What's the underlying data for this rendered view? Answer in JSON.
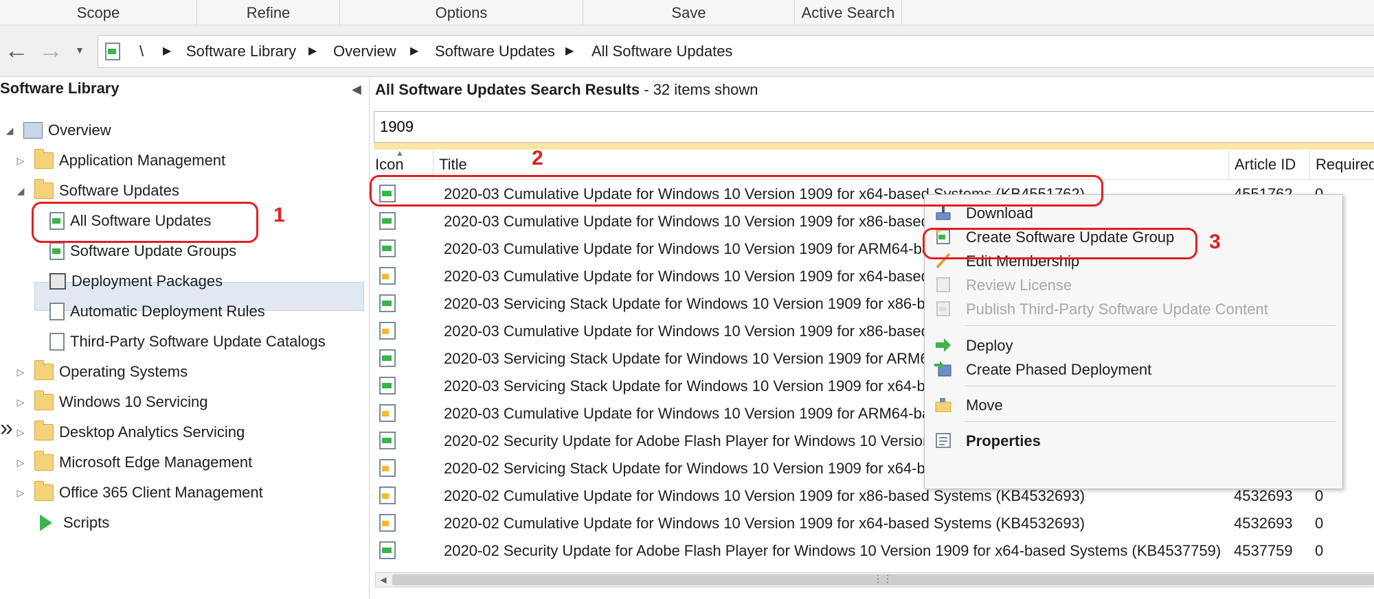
{
  "ribbon": {
    "groups": [
      "Scope",
      "Refine",
      "Options",
      "Save",
      "Active Search"
    ]
  },
  "address_bar": {
    "back_icon": "back-arrow-icon",
    "forward_icon": "forward-arrow-icon",
    "root": "\\",
    "crumbs": [
      "Software Library",
      "Overview",
      "Software Updates",
      "All Software Updates"
    ]
  },
  "navigation": {
    "title": "Software Library",
    "items": [
      {
        "label": "Overview",
        "icon": "overview-icon"
      },
      {
        "label": "Application Management",
        "icon": "folder-icon"
      },
      {
        "label": "Software Updates",
        "icon": "folder-icon"
      },
      {
        "label": "All Software Updates",
        "icon": "software-update-icon",
        "selected": true
      },
      {
        "label": "Software Update Groups",
        "icon": "update-group-icon"
      },
      {
        "label": "Deployment Packages",
        "icon": "package-icon"
      },
      {
        "label": "Automatic Deployment Rules",
        "icon": "rule-icon"
      },
      {
        "label": "Third-Party Software Update Catalogs",
        "icon": "catalog-icon"
      },
      {
        "label": "Operating Systems",
        "icon": "folder-icon"
      },
      {
        "label": "Windows 10 Servicing",
        "icon": "folder-icon"
      },
      {
        "label": "Desktop Analytics Servicing",
        "icon": "folder-icon"
      },
      {
        "label": "Microsoft Edge Management",
        "icon": "folder-icon"
      },
      {
        "label": "Office 365 Client Management",
        "icon": "folder-icon"
      },
      {
        "label": "Scripts",
        "icon": "script-icon"
      }
    ]
  },
  "results": {
    "title": "All Software Updates Search Results",
    "separator": " - ",
    "count": "32 items shown",
    "search_value": "1909",
    "columns": [
      "Icon",
      "Title",
      "Article ID",
      "Required"
    ],
    "rows": [
      {
        "title": "2020-03 Cumulative Update for Windows 10 Version 1909 for x64-based Systems (KB4551762)",
        "article": "4551762",
        "required": "0",
        "icon": "g"
      },
      {
        "title": "2020-03 Cumulative Update for Windows 10 Version 1909 for x86-based",
        "article": "",
        "required": "",
        "icon": "g"
      },
      {
        "title": "2020-03 Cumulative Update for Windows 10 Version 1909 for ARM64-ba",
        "article": "",
        "required": "",
        "icon": "g"
      },
      {
        "title": "2020-03 Cumulative Update for Windows 10 Version 1909 for x64-based",
        "article": "",
        "required": "",
        "icon": "y"
      },
      {
        "title": "2020-03 Servicing Stack Update for Windows 10 Version 1909 for x86-ba",
        "article": "",
        "required": "",
        "icon": "g"
      },
      {
        "title": "2020-03 Cumulative Update for Windows 10 Version 1909 for x86-based",
        "article": "",
        "required": "",
        "icon": "y"
      },
      {
        "title": "2020-03 Servicing Stack Update for Windows 10 Version 1909 for ARM64",
        "article": "",
        "required": "",
        "icon": "g"
      },
      {
        "title": "2020-03 Servicing Stack Update for Windows 10 Version 1909 for x64-ba",
        "article": "",
        "required": "",
        "icon": "g"
      },
      {
        "title": "2020-03 Cumulative Update for Windows 10 Version 1909 for ARM64-ba",
        "article": "",
        "required": "",
        "icon": "y"
      },
      {
        "title": "2020-02 Security Update for Adobe Flash Player for Windows 10 Version",
        "article": "",
        "required": "",
        "icon": "g"
      },
      {
        "title": "2020-02 Servicing Stack Update for Windows 10 Version 1909 for x64-ba",
        "article": "",
        "required": "",
        "icon": "y"
      },
      {
        "title": "2020-02 Cumulative Update for Windows 10 Version 1909 for x86-based Systems (KB4532693)",
        "article": "4532693",
        "required": "0",
        "icon": "y"
      },
      {
        "title": "2020-02 Cumulative Update for Windows 10 Version 1909 for x64-based Systems (KB4532693)",
        "article": "4532693",
        "required": "0",
        "icon": "y"
      },
      {
        "title": "2020-02 Security Update for Adobe Flash Player for Windows 10 Version 1909 for x64-based Systems (KB4537759)",
        "article": "4537759",
        "required": "0",
        "icon": "g"
      }
    ]
  },
  "context_menu": {
    "items": [
      {
        "label": "Download",
        "icon": "download-icon",
        "state": "normal"
      },
      {
        "label": "Create Software Update Group",
        "icon": "create-group-icon",
        "state": "normal"
      },
      {
        "label": "Edit Membership",
        "icon": "pencil-icon",
        "state": "normal"
      },
      {
        "label": "Review License",
        "icon": "license-icon",
        "state": "disabled"
      },
      {
        "label": "Publish Third-Party Software Update Content",
        "icon": "publish-icon",
        "state": "disabled"
      },
      {
        "label": "Deploy",
        "icon": "deploy-arrow-icon",
        "state": "normal"
      },
      {
        "label": "Create Phased Deployment",
        "icon": "phased-deployment-icon",
        "state": "normal"
      },
      {
        "label": "Move",
        "icon": "move-folder-icon",
        "state": "normal"
      },
      {
        "label": "Properties",
        "icon": "properties-icon",
        "state": "bold"
      }
    ]
  },
  "annotations": {
    "steps": [
      "1",
      "2",
      "3"
    ],
    "color": "#e02020"
  },
  "colors": {
    "selection": "#e1e8f2",
    "search_highlight": "#fbe6a6",
    "accent_green": "#39b54a"
  }
}
